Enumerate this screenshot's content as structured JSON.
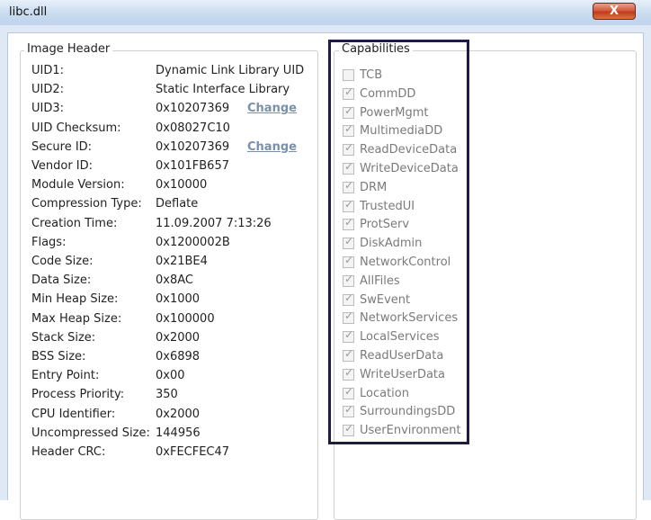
{
  "window": {
    "title": "libc.dll",
    "close_label": "X"
  },
  "image_header": {
    "legend": "Image Header",
    "change_label": "Change",
    "rows": [
      {
        "label": "UID1:",
        "value": "Dynamic Link Library UID"
      },
      {
        "label": "UID2:",
        "value": "Static Interface Library"
      },
      {
        "label": "UID3:",
        "value": "0x10207369",
        "has_change": true
      },
      {
        "label": "UID Checksum:",
        "value": "0x08027C10"
      },
      {
        "label": "Secure ID:",
        "value": "0x10207369",
        "has_change": true
      },
      {
        "label": "Vendor ID:",
        "value": "0x101FB657"
      },
      {
        "label": "Module Version:",
        "value": "0x10000"
      },
      {
        "label": "Compression Type:",
        "value": "Deflate"
      },
      {
        "label": "Creation Time:",
        "value": "11.09.2007 7:13:26"
      },
      {
        "label": "Flags:",
        "value": "0x1200002B"
      },
      {
        "label": "Code Size:",
        "value": "0x21BE4"
      },
      {
        "label": "Data Size:",
        "value": "0x8AC"
      },
      {
        "label": "Min Heap Size:",
        "value": "0x1000"
      },
      {
        "label": "Max Heap Size:",
        "value": "0x100000"
      },
      {
        "label": "Stack Size:",
        "value": "0x2000"
      },
      {
        "label": "BSS Size:",
        "value": "0x6898"
      },
      {
        "label": "Entry Point:",
        "value": "0x00"
      },
      {
        "label": "Process Priority:",
        "value": "350"
      },
      {
        "label": "CPU Identifier:",
        "value": "0x2000"
      },
      {
        "label": "Uncompressed Size:",
        "value": "144956"
      },
      {
        "label": "Header CRC:",
        "value": "0xFECFEC47"
      }
    ]
  },
  "capabilities": {
    "legend": "Capabilities",
    "items": [
      {
        "label": "TCB",
        "checked": false
      },
      {
        "label": "CommDD",
        "checked": true
      },
      {
        "label": "PowerMgmt",
        "checked": true
      },
      {
        "label": "MultimediaDD",
        "checked": true
      },
      {
        "label": "ReadDeviceData",
        "checked": true
      },
      {
        "label": "WriteDeviceData",
        "checked": true
      },
      {
        "label": "DRM",
        "checked": true
      },
      {
        "label": "TrustedUI",
        "checked": true
      },
      {
        "label": "ProtServ",
        "checked": true
      },
      {
        "label": "DiskAdmin",
        "checked": true
      },
      {
        "label": "NetworkControl",
        "checked": true
      },
      {
        "label": "AllFiles",
        "checked": true
      },
      {
        "label": "SwEvent",
        "checked": true
      },
      {
        "label": "NetworkServices",
        "checked": true
      },
      {
        "label": "LocalServices",
        "checked": true
      },
      {
        "label": "ReadUserData",
        "checked": true
      },
      {
        "label": "WriteUserData",
        "checked": true
      },
      {
        "label": "Location",
        "checked": true
      },
      {
        "label": "SurroundingsDD",
        "checked": true
      },
      {
        "label": "UserEnvironment",
        "checked": true
      }
    ]
  },
  "colors": {
    "highlight_border": "#1e1b4a",
    "link": "#7a90a8",
    "disabled_text": "#7a7a7a"
  }
}
